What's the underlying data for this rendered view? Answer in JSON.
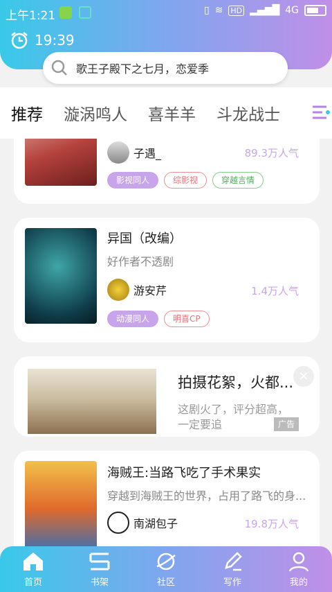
{
  "status": {
    "time": "上午1:21",
    "network": "4G",
    "hd": "HD"
  },
  "header": {
    "clock_time": "19:39",
    "search_placeholder": "歌王子殿下之七月，恋爱季"
  },
  "tabs": [
    {
      "label": "推荐",
      "active": true
    },
    {
      "label": "漩涡鸣人"
    },
    {
      "label": "喜羊羊"
    },
    {
      "label": "斗龙战士"
    }
  ],
  "cards": [
    {
      "title": "",
      "author": "子遇_",
      "popularity": "89.3万人气",
      "tags": [
        {
          "label": "影视同人",
          "style": "purple"
        },
        {
          "label": "综影视",
          "style": "red"
        },
        {
          "label": "穿越言情",
          "style": "green"
        }
      ]
    },
    {
      "title": "异国（改编）",
      "desc": "好作者不透剧",
      "author": "游安芹",
      "popularity": "1.4万人气",
      "tags": [
        {
          "label": "动漫同人",
          "style": "purple"
        },
        {
          "label": "明喜CP",
          "style": "red"
        }
      ]
    },
    {
      "title": "海贼王:当路飞吃了手术果实",
      "desc": "穿越到海贼王的世界，占用了路飞的身...",
      "author": "南湖包子",
      "popularity": "19.8万人气",
      "tags": []
    }
  ],
  "ad": {
    "title": "拍摄花絮，火都...",
    "desc": "这剧火了，评分超高，一定要追",
    "badge": "广告",
    "close": "×"
  },
  "bottom_nav": [
    {
      "label": "首页",
      "icon": "home-icon"
    },
    {
      "label": "书架",
      "icon": "bookshelf-icon"
    },
    {
      "label": "社区",
      "icon": "planet-icon"
    },
    {
      "label": "写作",
      "icon": "pen-icon"
    },
    {
      "label": "我的",
      "icon": "user-icon"
    }
  ],
  "colors": {
    "accent": "#c08fe8",
    "cyan": "#39c9e8",
    "popularity": "#c6a6e8"
  }
}
